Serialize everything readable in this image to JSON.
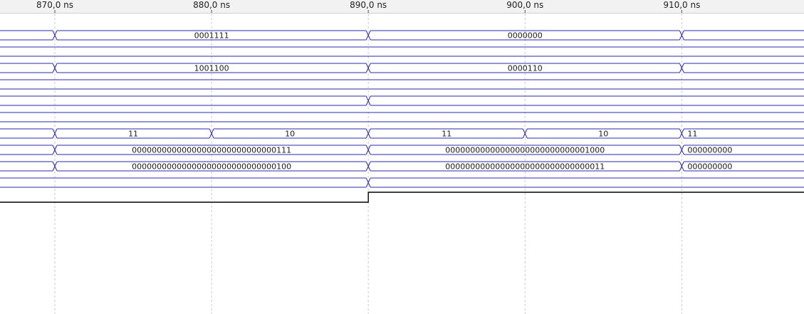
{
  "colors": {
    "signal": "#2a2ab0",
    "digital": "#000000",
    "grid": "#c8c8c8",
    "ruler_bg": "#f2f2f2"
  },
  "timeline": {
    "visible_start_ns": 866.5,
    "visible_end_ns": 917.8,
    "tick_labels": [
      {
        "ns": 870,
        "label": "870,0 ns"
      },
      {
        "ns": 880,
        "label": "880,0 ns"
      },
      {
        "ns": 890,
        "label": "890,0 ns"
      },
      {
        "ns": 900,
        "label": "900,0 ns"
      },
      {
        "ns": 910,
        "label": "910,0 ns"
      }
    ]
  },
  "signals": [
    {
      "id": "bus-1",
      "kind": "bus",
      "segments": [
        {
          "start": 866.5,
          "end": 870,
          "value": ""
        },
        {
          "start": 870,
          "end": 890,
          "value": "0001111"
        },
        {
          "start": 890,
          "end": 910,
          "value": "0000000"
        },
        {
          "start": 910,
          "end": 917.8,
          "value": ""
        }
      ]
    },
    {
      "id": "bus-2",
      "kind": "bus",
      "segments": [
        {
          "start": 866.5,
          "end": 917.8,
          "value": ""
        }
      ]
    },
    {
      "id": "bus-3",
      "kind": "bus",
      "segments": [
        {
          "start": 866.5,
          "end": 870,
          "value": ""
        },
        {
          "start": 870,
          "end": 890,
          "value": "1001100"
        },
        {
          "start": 890,
          "end": 910,
          "value": "0000110"
        },
        {
          "start": 910,
          "end": 917.8,
          "value": ""
        }
      ]
    },
    {
      "id": "bus-4",
      "kind": "bus",
      "segments": [
        {
          "start": 866.5,
          "end": 917.8,
          "value": ""
        }
      ]
    },
    {
      "id": "bus-5",
      "kind": "bus",
      "segments": [
        {
          "start": 866.5,
          "end": 890,
          "value": ""
        },
        {
          "start": 890,
          "end": 917.8,
          "value": ""
        }
      ]
    },
    {
      "id": "bus-6",
      "kind": "bus",
      "segments": [
        {
          "start": 866.5,
          "end": 917.8,
          "value": ""
        }
      ]
    },
    {
      "id": "bus-7",
      "kind": "bus",
      "segments": [
        {
          "start": 866.5,
          "end": 870,
          "value": ""
        },
        {
          "start": 870,
          "end": 880,
          "value": "11"
        },
        {
          "start": 880,
          "end": 890,
          "value": "10"
        },
        {
          "start": 890,
          "end": 900,
          "value": "11"
        },
        {
          "start": 900,
          "end": 910,
          "value": "10"
        },
        {
          "start": 910,
          "end": 917.8,
          "value": "11"
        }
      ]
    },
    {
      "id": "bus-8",
      "kind": "bus",
      "segments": [
        {
          "start": 866.5,
          "end": 870,
          "value": ""
        },
        {
          "start": 870,
          "end": 890,
          "value": "00000000000000000000000000000111"
        },
        {
          "start": 890,
          "end": 910,
          "value": "00000000000000000000000000001000"
        },
        {
          "start": 910,
          "end": 917.8,
          "value": "000000000"
        }
      ]
    },
    {
      "id": "bus-9",
      "kind": "bus",
      "segments": [
        {
          "start": 866.5,
          "end": 870,
          "value": ""
        },
        {
          "start": 870,
          "end": 890,
          "value": "00000000000000000000000000000100"
        },
        {
          "start": 890,
          "end": 910,
          "value": "00000000000000000000000000000011"
        },
        {
          "start": 910,
          "end": 917.8,
          "value": "000000000"
        }
      ]
    },
    {
      "id": "bus-10",
      "kind": "bus",
      "segments": [
        {
          "start": 866.5,
          "end": 890,
          "value": ""
        },
        {
          "start": 890,
          "end": 917.8,
          "value": ""
        }
      ]
    },
    {
      "id": "wire-1",
      "kind": "digital",
      "transitions": [
        {
          "ns": 866.5,
          "level": 0
        },
        {
          "ns": 890,
          "level": 1
        }
      ]
    }
  ]
}
